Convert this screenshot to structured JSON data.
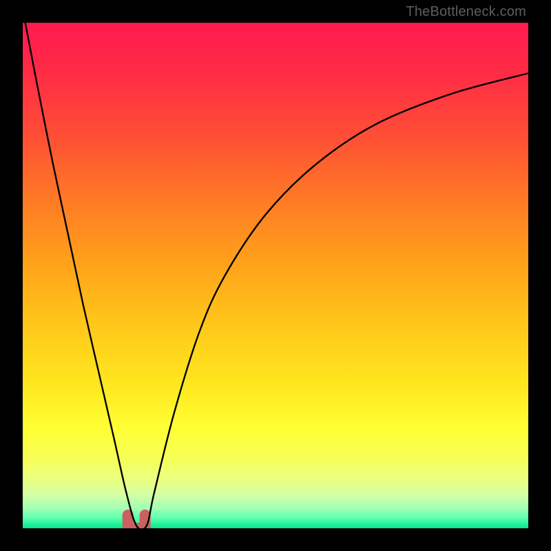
{
  "watermark": "TheBottleneck.com",
  "gradient_stops": [
    {
      "offset": 0.0,
      "color": "#ff1a4f"
    },
    {
      "offset": 0.1,
      "color": "#ff2c45"
    },
    {
      "offset": 0.22,
      "color": "#ff4d36"
    },
    {
      "offset": 0.35,
      "color": "#ff7a25"
    },
    {
      "offset": 0.48,
      "color": "#ffa31a"
    },
    {
      "offset": 0.6,
      "color": "#ffc81a"
    },
    {
      "offset": 0.72,
      "color": "#ffe81f"
    },
    {
      "offset": 0.8,
      "color": "#ffff33"
    },
    {
      "offset": 0.86,
      "color": "#f7ff55"
    },
    {
      "offset": 0.905,
      "color": "#eaff82"
    },
    {
      "offset": 0.935,
      "color": "#d2ffa6"
    },
    {
      "offset": 0.96,
      "color": "#a3ffb3"
    },
    {
      "offset": 0.98,
      "color": "#5bffb0"
    },
    {
      "offset": 1.0,
      "color": "#00e887"
    }
  ],
  "chart_data": {
    "type": "line",
    "title": "",
    "xlabel": "",
    "ylabel": "",
    "xlim": [
      0,
      100
    ],
    "ylim": [
      0,
      100
    ],
    "series": [
      {
        "name": "bottleneck-curve",
        "x": [
          0.5,
          3,
          6,
          9,
          12,
          15,
          18,
          20.5,
          22.5,
          24.5,
          26,
          30,
          35,
          40,
          48,
          58,
          70,
          85,
          100
        ],
        "y": [
          100,
          87,
          72,
          58,
          44,
          31,
          18,
          7,
          0.5,
          0.5,
          7,
          23,
          39,
          50,
          62,
          72,
          80,
          86,
          90
        ]
      }
    ],
    "trough_marker": {
      "color": "#cc6060",
      "x_start": 20.8,
      "x_end": 24.2,
      "y_bottom": 0.0,
      "y_top": 2.6
    },
    "annotations": []
  }
}
